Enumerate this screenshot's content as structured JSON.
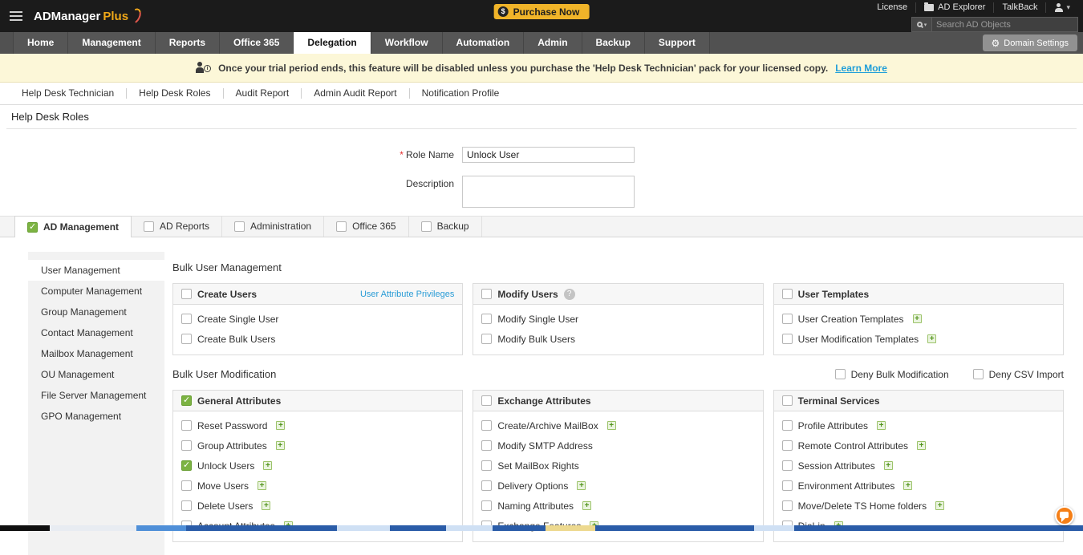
{
  "colors": {
    "accent_yellow": "#f0b429",
    "brand_orange": "#f57f17",
    "checked_green": "#7cb342",
    "link_blue": "#2a9cd6"
  },
  "icons": {
    "caret_down": "▾",
    "gear": "⚙"
  },
  "topbar": {
    "logo_main": "ADManager",
    "logo_plus": "Plus",
    "purchase": "Purchase Now",
    "links": {
      "license": "License",
      "ad_explorer": "AD Explorer",
      "talkback": "TalkBack"
    },
    "search_placeholder": "Search AD Objects"
  },
  "nav": {
    "tabs": [
      "Home",
      "Management",
      "Reports",
      "Office 365",
      "Delegation",
      "Workflow",
      "Automation",
      "Admin",
      "Backup",
      "Support"
    ],
    "active_tab": "Delegation",
    "domain_settings": "Domain Settings"
  },
  "banner": {
    "message": "Once your trial period ends, this feature will be disabled unless you purchase the 'Help Desk Technician' pack for your licensed copy.",
    "link": "Learn More"
  },
  "subnav": [
    "Help Desk Technician",
    "Help Desk Roles",
    "Audit Report",
    "Admin Audit Report",
    "Notification Profile"
  ],
  "page_title": "Help Desk Roles",
  "form": {
    "role_name": {
      "label": "Role Name",
      "required_mark": "*",
      "value": "Unlock User"
    },
    "description": {
      "label": "Description",
      "value": ""
    }
  },
  "category_tabs": [
    {
      "label": "AD Management",
      "checked": true,
      "active": true
    },
    {
      "label": "AD Reports",
      "checked": false,
      "active": false
    },
    {
      "label": "Administration",
      "checked": false,
      "active": false
    },
    {
      "label": "Office 365",
      "checked": false,
      "active": false
    },
    {
      "label": "Backup",
      "checked": false,
      "active": false
    }
  ],
  "sidebar": [
    {
      "label": "User Management",
      "active": true
    },
    {
      "label": "Computer Management",
      "active": false
    },
    {
      "label": "Group Management",
      "active": false
    },
    {
      "label": "Contact Management",
      "active": false
    },
    {
      "label": "Mailbox Management",
      "active": false
    },
    {
      "label": "OU Management",
      "active": false
    },
    {
      "label": "File Server Management",
      "active": false
    },
    {
      "label": "GPO Management",
      "active": false
    }
  ],
  "sections": [
    {
      "title": "Bulk User Management",
      "header_checks": [],
      "panels": [
        {
          "title": "Create Users",
          "checked": false,
          "link": "User Attribute Privileges",
          "items": [
            {
              "label": "Create Single User",
              "checked": false,
              "plus": false
            },
            {
              "label": "Create Bulk Users",
              "checked": false,
              "plus": false
            }
          ]
        },
        {
          "title": "Modify Users",
          "checked": false,
          "help": true,
          "items": [
            {
              "label": "Modify Single User",
              "checked": false,
              "plus": false
            },
            {
              "label": "Modify Bulk Users",
              "checked": false,
              "plus": false
            }
          ]
        },
        {
          "title": "User Templates",
          "checked": false,
          "items": [
            {
              "label": "User Creation Templates",
              "checked": false,
              "plus": true
            },
            {
              "label": "User Modification Templates",
              "checked": false,
              "plus": true
            }
          ]
        }
      ]
    },
    {
      "title": "Bulk User Modification",
      "header_checks": [
        {
          "label": "Deny Bulk Modification",
          "checked": false
        },
        {
          "label": "Deny CSV Import",
          "checked": false
        }
      ],
      "panels": [
        {
          "title": "General Attributes",
          "checked": true,
          "items": [
            {
              "label": "Reset Password",
              "checked": false,
              "plus": true
            },
            {
              "label": "Group Attributes",
              "checked": false,
              "plus": true
            },
            {
              "label": "Unlock Users",
              "checked": true,
              "plus": true
            },
            {
              "label": "Move Users",
              "checked": false,
              "plus": true
            },
            {
              "label": "Delete Users",
              "checked": false,
              "plus": true
            },
            {
              "label": "Account Attributes",
              "checked": false,
              "plus": true
            }
          ]
        },
        {
          "title": "Exchange Attributes",
          "checked": false,
          "items": [
            {
              "label": "Create/Archive MailBox",
              "checked": false,
              "plus": true
            },
            {
              "label": "Modify SMTP Address",
              "checked": false,
              "plus": false
            },
            {
              "label": "Set MailBox Rights",
              "checked": false,
              "plus": false
            },
            {
              "label": "Delivery Options",
              "checked": false,
              "plus": true
            },
            {
              "label": "Naming Attributes",
              "checked": false,
              "plus": true
            },
            {
              "label": "Exchange Features",
              "checked": false,
              "plus": true
            }
          ]
        },
        {
          "title": "Terminal Services",
          "checked": false,
          "items": [
            {
              "label": "Profile Attributes",
              "checked": false,
              "plus": true
            },
            {
              "label": "Remote Control Attributes",
              "checked": false,
              "plus": true
            },
            {
              "label": "Session Attributes",
              "checked": false,
              "plus": true
            },
            {
              "label": "Environment Attributes",
              "checked": false,
              "plus": true
            },
            {
              "label": "Move/Delete TS Home folders",
              "checked": false,
              "plus": true
            },
            {
              "label": "Dial-in",
              "checked": false,
              "plus": true
            }
          ]
        }
      ]
    }
  ]
}
